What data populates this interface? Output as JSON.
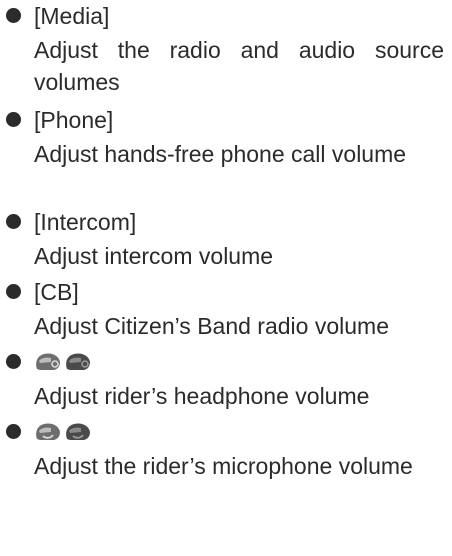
{
  "items": [
    {
      "label": "[Media]",
      "description": "Adjust the radio and audio source volumes"
    },
    {
      "label": "[Phone]",
      "description": "Adjust hands-free phone call volume"
    },
    {
      "label": "[Intercom]",
      "description": "Adjust intercom volume"
    },
    {
      "label": "[CB]",
      "description": "Adjust Citizen’s Band radio volume"
    },
    {
      "icon": "rider-headphone-icon",
      "description": "Adjust rider’s headphone volume"
    },
    {
      "icon": "rider-microphone-icon",
      "description": "Adjust the rider’s microphone volume"
    }
  ],
  "colors": {
    "text": "#2b2b2b",
    "icon_fill": "#6e6e6e",
    "icon_highlight": "#d9d9d9"
  }
}
